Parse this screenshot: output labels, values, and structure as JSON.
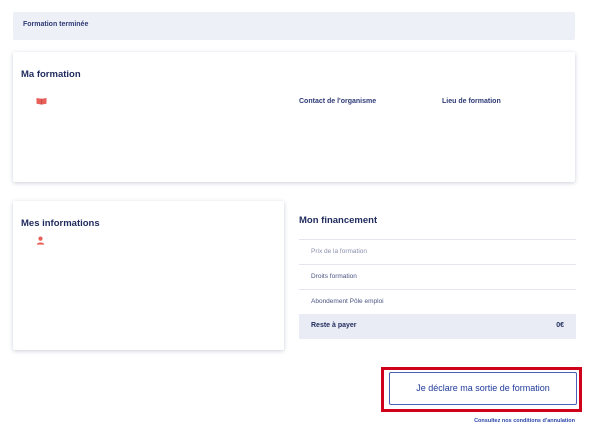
{
  "status": {
    "label": "Formation terminée"
  },
  "formation_card": {
    "title": "Ma formation",
    "icon": "book-icon",
    "contact_label": "Contact de l'organisme",
    "lieu_label": "Lieu de formation"
  },
  "infos_card": {
    "title": "Mes informations",
    "icon": "user-icon"
  },
  "financement": {
    "title": "Mon financement",
    "rows": [
      {
        "label": "Prix de la formation"
      },
      {
        "label": "Droits formation"
      },
      {
        "label": "Abondement Pôle emploi"
      }
    ],
    "total_label": "Reste à payer",
    "total_amount": "0€"
  },
  "actions": {
    "declare_button": "Je déclare ma sortie de formation",
    "cancel_link": "Consultez nos conditions d'annulation"
  },
  "colors": {
    "accent": "#e1000f",
    "navy": "#1f2a5c",
    "highlight": "#d0021b"
  }
}
